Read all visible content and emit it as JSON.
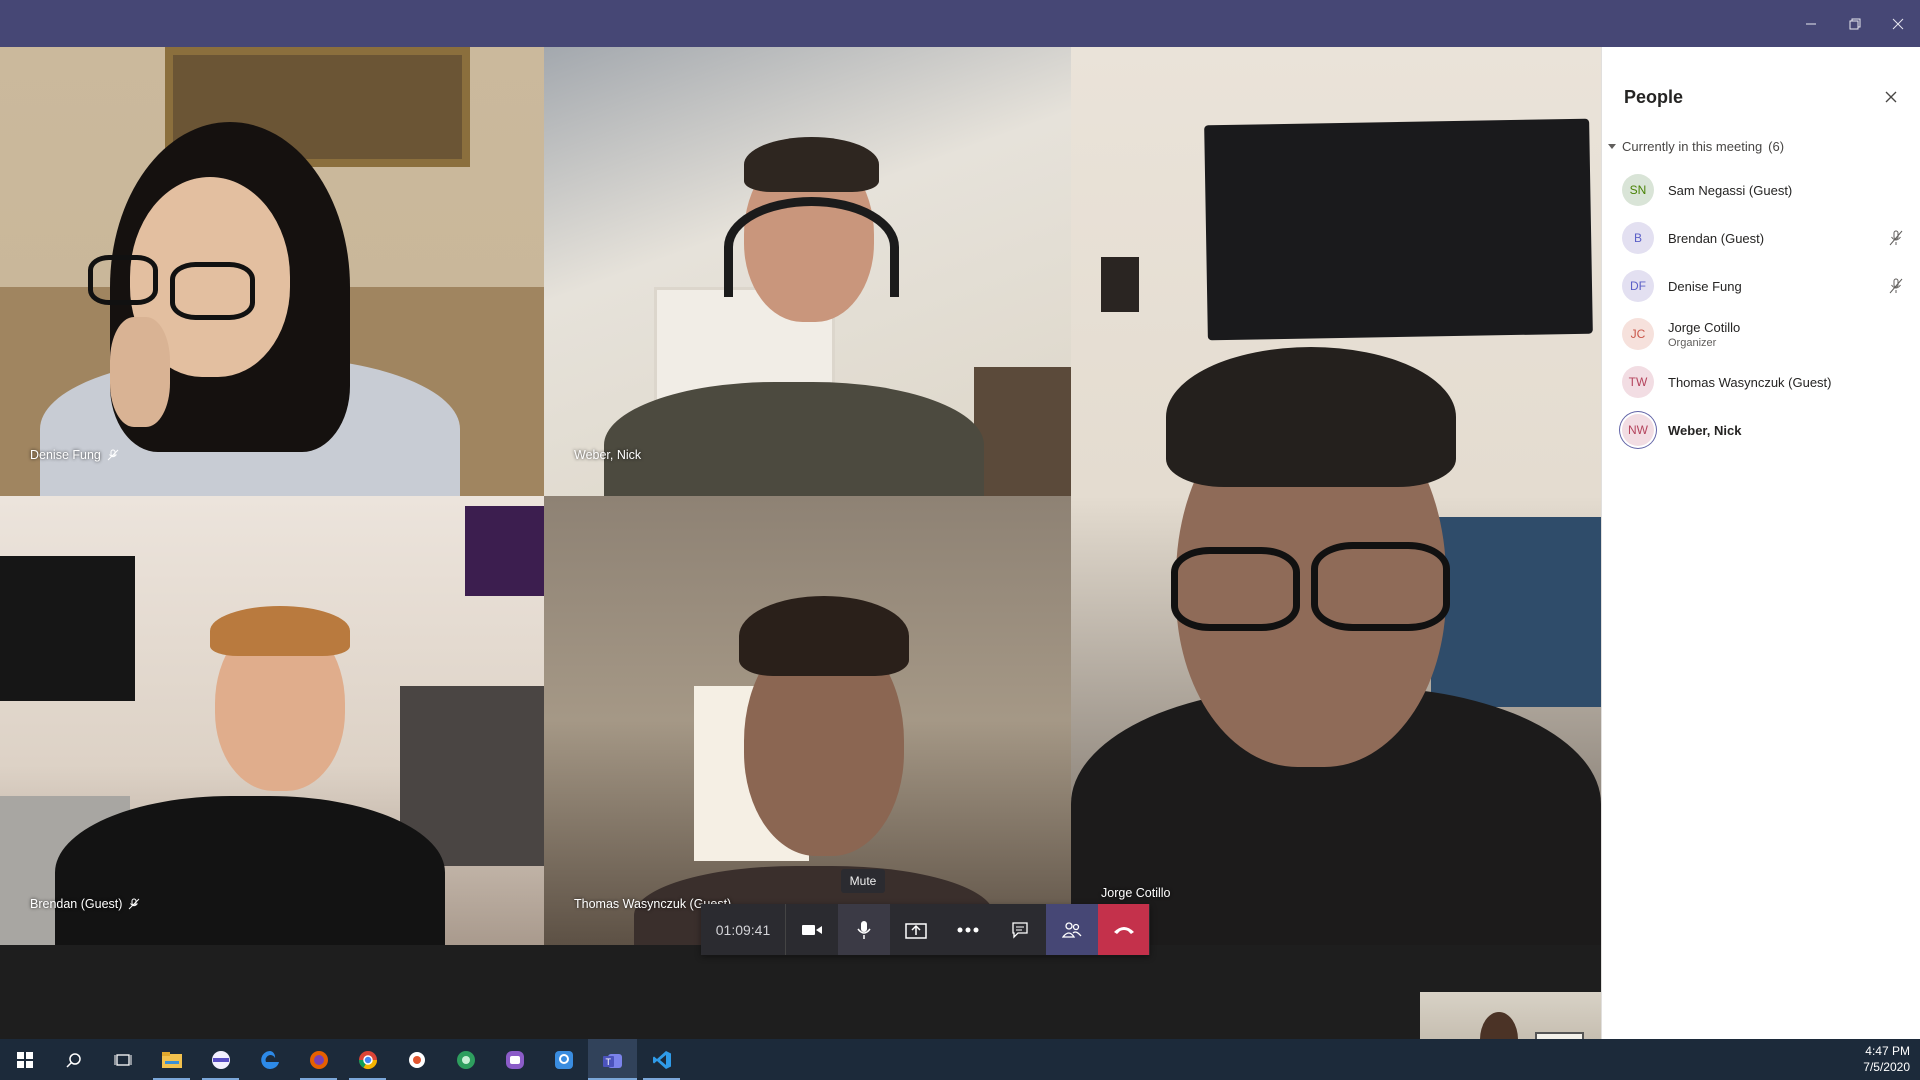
{
  "window": {
    "controls": [
      "minimize",
      "restore",
      "close"
    ]
  },
  "participants_video": [
    {
      "name": "Denise Fung",
      "muted": true
    },
    {
      "name": "Weber, Nick",
      "muted": false
    },
    {
      "name": "Jorge Cotillo",
      "muted": false
    },
    {
      "name": "Brendan (Guest)",
      "muted": true
    },
    {
      "name": "Thomas Wasynczuk (Guest)",
      "muted": false
    }
  ],
  "call_controls": {
    "timer": "01:09:41",
    "tooltip": "Mute",
    "buttons": [
      "camera-icon",
      "microphone-icon",
      "share-screen-icon",
      "more-options-icon",
      "chat-icon",
      "participants-icon",
      "hang-up-icon"
    ]
  },
  "people_panel": {
    "title": "People",
    "section_label": "Currently in this meeting",
    "section_count": "(6)",
    "people": [
      {
        "initials": "SN",
        "name": "Sam Negassi (Guest)",
        "role": "",
        "muted": false,
        "color": "#d9e4d7",
        "text_color": "#498205"
      },
      {
        "initials": "B",
        "name": "Brendan (Guest)",
        "role": "",
        "muted": true,
        "color": "#e3e0f1",
        "text_color": "#5b5fc7"
      },
      {
        "initials": "DF",
        "name": "Denise Fung",
        "role": "",
        "muted": true,
        "color": "#e3e0f1",
        "text_color": "#5b5fc7"
      },
      {
        "initials": "JC",
        "name": "Jorge Cotillo",
        "role": "Organizer",
        "muted": false,
        "color": "#f6e1dc",
        "text_color": "#c9574a"
      },
      {
        "initials": "TW",
        "name": "Thomas Wasynczuk (Guest)",
        "role": "",
        "muted": false,
        "color": "#f2dde3",
        "text_color": "#b4445d"
      },
      {
        "initials": "NW",
        "name": "Weber, Nick",
        "role": "",
        "muted": false,
        "color": "#f2dde3",
        "text_color": "#b4445d",
        "self": true
      }
    ]
  },
  "taskbar": {
    "time": "4:47 PM",
    "date": "7/5/2020",
    "apps": [
      "windows-start-icon",
      "search-icon",
      "task-view-icon",
      "file-explorer-icon",
      "app-icon",
      "edge-icon",
      "firefox-icon",
      "chrome-icon",
      "app-icon-2",
      "app-icon-3",
      "app-icon-4",
      "app-icon-5",
      "teams-icon",
      "vscode-icon"
    ]
  },
  "colors": {
    "titlebar": "#464775",
    "hangup": "#c4314b",
    "accent": "#5b5fc7"
  }
}
